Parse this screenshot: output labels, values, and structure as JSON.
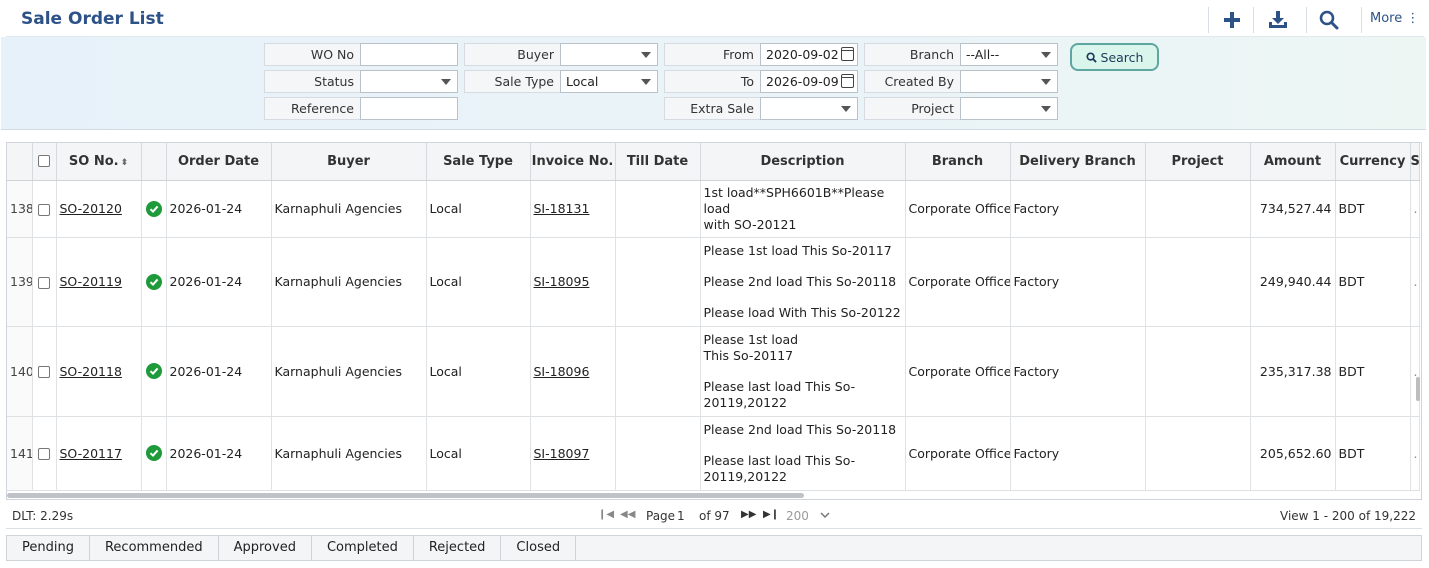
{
  "header": {
    "title": "Sale Order List",
    "more_label": "More ⋮",
    "icons": [
      "add-icon",
      "download-icon",
      "search-icon"
    ],
    "accent_color": "#2d5287"
  },
  "filters": {
    "wo_no": {
      "label": "WO No",
      "value": ""
    },
    "buyer": {
      "label": "Buyer",
      "value": ""
    },
    "from": {
      "label": "From",
      "value": "2020-09-02"
    },
    "branch": {
      "label": "Branch",
      "value": "--All--"
    },
    "status": {
      "label": "Status",
      "value": ""
    },
    "sale_type": {
      "label": "Sale Type",
      "value": "Local"
    },
    "to": {
      "label": "To",
      "value": "2026-09-09"
    },
    "created_by": {
      "label": "Created By",
      "value": ""
    },
    "reference": {
      "label": "Reference",
      "value": ""
    },
    "extra_sale": {
      "label": "Extra Sale",
      "value": ""
    },
    "project": {
      "label": "Project",
      "value": ""
    },
    "search_label": "Search"
  },
  "columns": [
    "SO No.",
    "Order Date",
    "Buyer",
    "Sale Type",
    "Invoice No.",
    "Till Date",
    "Description",
    "Branch",
    "Delivery Branch",
    "Project",
    "Amount",
    "Currency",
    "S"
  ],
  "rows": [
    {
      "rn": "138",
      "so": "SO-20120",
      "date": "2026-01-24",
      "buyer": "Karnaphuli Agencies",
      "type": "Local",
      "inv": "SI-18131",
      "till": "",
      "desc": [
        "1st load**SPH6601B**Please load",
        "with SO-20121"
      ],
      "branch": "Corporate Office",
      "dbranch": "Factory",
      "project": "",
      "amount": "734,527.44",
      "cur": "BDT"
    },
    {
      "rn": "139",
      "so": "SO-20119",
      "date": "2026-01-24",
      "buyer": "Karnaphuli Agencies",
      "type": "Local",
      "inv": "SI-18095",
      "till": "",
      "desc": [
        "Please 1st load This So-20117",
        "",
        "Please 2nd load This So-20118",
        "",
        "Please load With This So-20122"
      ],
      "branch": "Corporate Office",
      "dbranch": "Factory",
      "project": "",
      "amount": "249,940.44",
      "cur": "BDT"
    },
    {
      "rn": "140",
      "so": "SO-20118",
      "date": "2026-01-24",
      "buyer": "Karnaphuli Agencies",
      "type": "Local",
      "inv": "SI-18096",
      "till": "",
      "desc": [
        "Please 1st load",
        "This So-20117",
        "",
        "Please last load This So-",
        "20119,20122"
      ],
      "branch": "Corporate Office",
      "dbranch": "Factory",
      "project": "",
      "amount": "235,317.38",
      "cur": "BDT"
    },
    {
      "rn": "141",
      "so": "SO-20117",
      "date": "2026-01-24",
      "buyer": "Karnaphuli Agencies",
      "type": "Local",
      "inv": "SI-18097",
      "till": "",
      "desc": [
        "Please 2nd load This So-20118",
        "",
        "Please last load This So-",
        "20119,20122"
      ],
      "branch": "Corporate Office",
      "dbranch": "Factory",
      "project": "",
      "amount": "205,652.60",
      "cur": "BDT"
    }
  ],
  "pager": {
    "dlt": "DLT: 2.29s",
    "page_label": "Page",
    "page": "1",
    "of": "of 97",
    "page_size": "200",
    "view": "View 1 - 200 of 19,222"
  },
  "tabs": [
    "Pending",
    "Recommended",
    "Approved",
    "Completed",
    "Rejected",
    "Closed"
  ]
}
